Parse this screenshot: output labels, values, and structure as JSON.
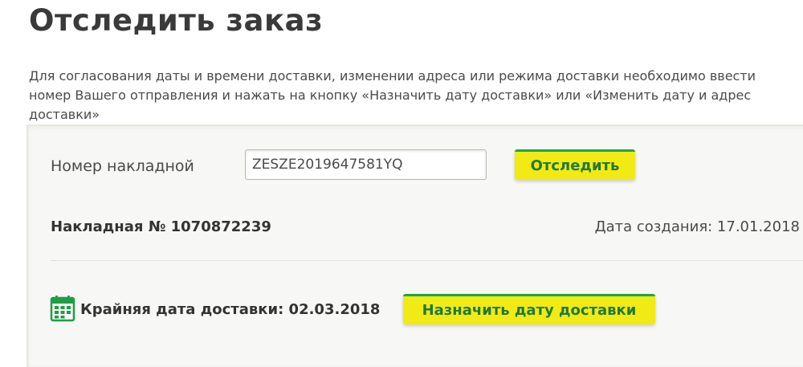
{
  "header": {
    "title": "Отследить заказ"
  },
  "intro": {
    "text": "Для согласования даты и времени доставки, изменении адреса или режима доставки необходимо ввести номер Вашего отправления и нажать на кнопку «Назначить дату доставки» или «Изменить дату и адрес доставки»"
  },
  "tracking_form": {
    "label": "Номер накладной",
    "input_value": "ZESZE2019647581YQ",
    "track_button_label": "Отследить"
  },
  "result": {
    "waybill_label": "Накладная № 1070872239",
    "created_label": "Дата создания: 17.01.2018",
    "deadline_label": "Крайняя дата доставки: 02.03.2018",
    "schedule_button_label": "Назначить дату доставки"
  },
  "colors": {
    "button_bg": "#f2ea14",
    "button_accent": "#19a84b",
    "button_text": "#1e7a3a",
    "calendar_icon": "#1f9e45"
  },
  "icons": {
    "calendar": "calendar-icon"
  }
}
